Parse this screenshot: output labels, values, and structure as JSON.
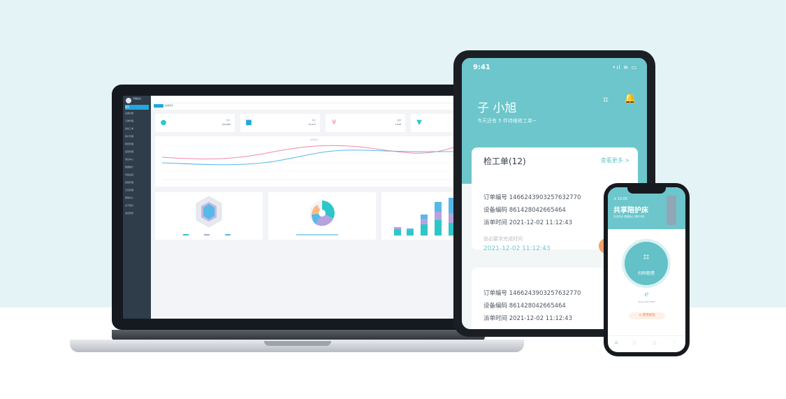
{
  "laptop": {
    "sidebar": {
      "brand": "管理后台",
      "items": [
        "首页",
        "设备管理",
        "订单管理",
        "巡检工单",
        "用户管理",
        "财务管理",
        "运营管理",
        "消息中心",
        "数据统计",
        "系统设置",
        "权限管理",
        "日志管理",
        "帮助中心",
        "关于我们",
        "退出登录"
      ]
    },
    "tabs": [
      "首页",
      "数据概览"
    ],
    "stats": [
      {
        "icon": "user-icon",
        "label": "用户",
        "value": "183,868"
      },
      {
        "icon": "message-icon",
        "label": "消息",
        "value": "23,973"
      },
      {
        "icon": "yuan-icon",
        "label": "金额",
        "value": "7,838"
      },
      {
        "icon": "cart-icon",
        "label": "订单",
        "value": "--"
      }
    ],
    "line_legend": [
      "新增用户",
      "活跃用户"
    ],
    "colors": {
      "accent": "#23a6de",
      "pink": "#f08aa6",
      "blue": "#57b9e8",
      "purple": "#b6a2de",
      "teal": "#2ec7c9"
    }
  },
  "tablet": {
    "time": "9:41",
    "status": "•ıl ≋ ▭",
    "greeting": "子 小旭",
    "subtitle": "今天还有 5 件待维修工单~",
    "scan_icon": "⌗",
    "bell_icon": "🔔",
    "section_title": "检工单(12)",
    "more": "查看更多 >",
    "order1": {
      "order_no": "订单编号 1466243903257632770",
      "device_no": "设备编码 861428042665464",
      "time": "派单时间 2021-12-02 11:12:43",
      "due_label": "前必要求完成时间",
      "due_time": "2021-12-02 11:12:43"
    },
    "order2": {
      "order_no": "订单编号 1466243903257632770",
      "device_no": "设备编码 861428042665464",
      "time": "派单时间 2021-12-02 11:12:43"
    }
  },
  "phone": {
    "time": "⊙ 15:05",
    "title": "共享陪护床",
    "tags": "安全舒适  便捷省心  随时可用",
    "scan_label": "扫码租借",
    "logo": "ℯ",
    "small_text": "SCAN AND RENT",
    "pill": "⊘ 使用教程"
  }
}
